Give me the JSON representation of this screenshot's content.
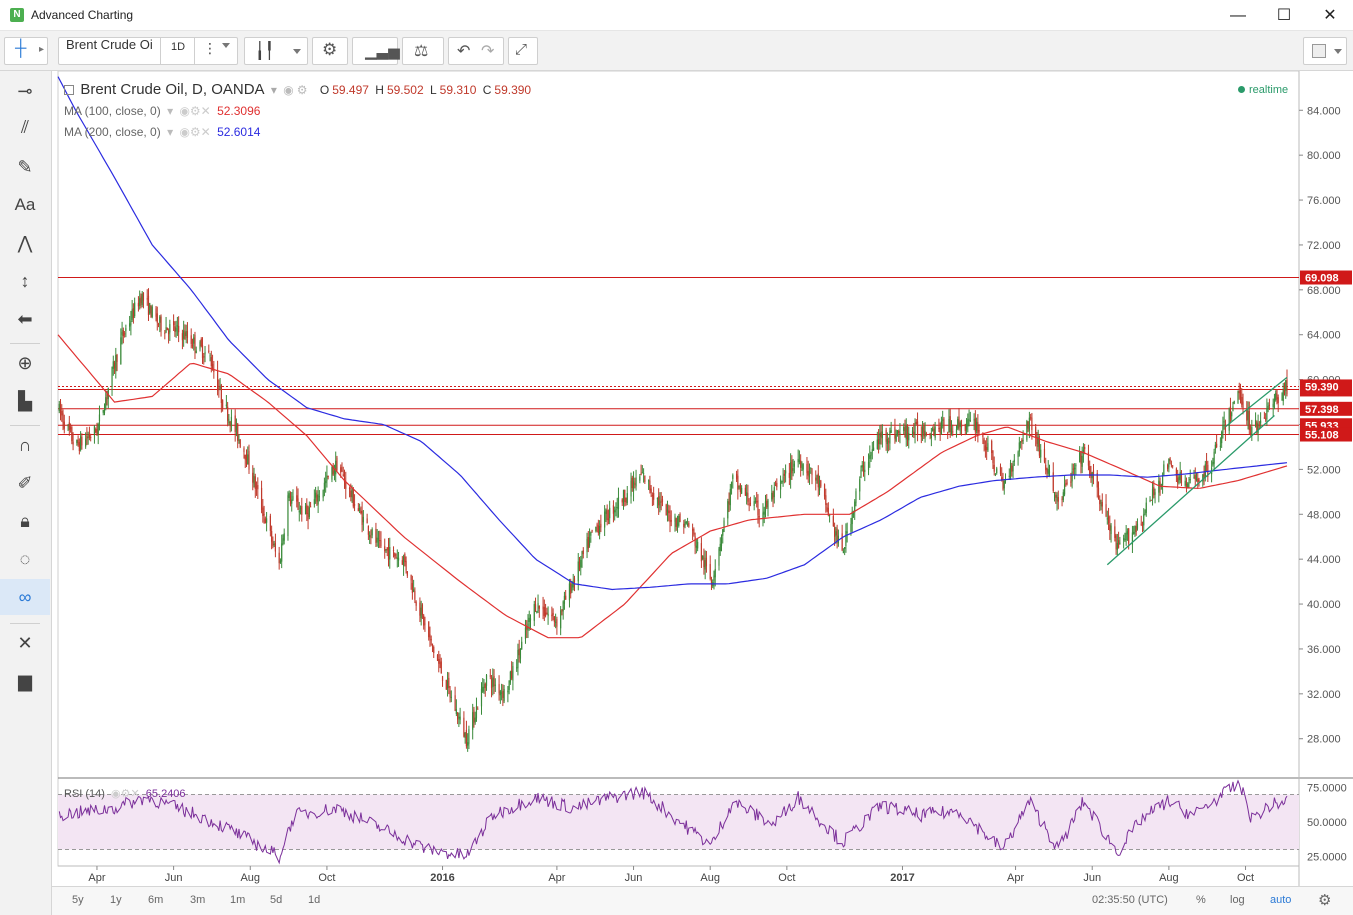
{
  "window": {
    "title": "Advanced Charting",
    "minimize": "—",
    "maximize": "☐",
    "close": "✕"
  },
  "toolbar": {
    "symbol": "Brent Crude Oi",
    "interval": "1D"
  },
  "legend": {
    "title": "Brent Crude Oil, D, OANDA",
    "ohlc": {
      "o_label": "O",
      "o": "59.497",
      "h_label": "H",
      "h": "59.502",
      "l_label": "L",
      "l": "59.310",
      "c_label": "C",
      "c": "59.390"
    },
    "ma100": {
      "label": "MA (100, close, 0)",
      "value": "52.3096"
    },
    "ma200": {
      "label": "MA (200, close, 0)",
      "value": "52.6014"
    },
    "realtime": "realtime",
    "rsi": {
      "label": "RSI (14)",
      "value": "65.2406"
    }
  },
  "bottombar": {
    "ranges": [
      "5y",
      "1y",
      "6m",
      "3m",
      "1m",
      "5d",
      "1d"
    ],
    "time": "02:35:50 (UTC)",
    "percent": "%",
    "log": "log",
    "auto": "auto"
  },
  "colors": {
    "up": "#3a8a3a",
    "down": "#c0392b",
    "ma100": "#e03131",
    "ma200": "#2b2be0",
    "level": "#d01919",
    "trend": "#2a9a6a",
    "rsi": "#7b2f9a",
    "rsi_band": "#f3e5f3"
  },
  "chart_data": {
    "type": "candlestick",
    "symbol": "Brent Crude Oil, D, OANDA",
    "y_ticks": [
      "84.000",
      "80.000",
      "76.000",
      "72.000",
      "68.000",
      "64.000",
      "60.000",
      "56.000",
      "52.000",
      "48.000",
      "44.000",
      "40.000",
      "36.000",
      "32.000",
      "28.000"
    ],
    "ylim": [
      24.5,
      87.5
    ],
    "x_ticks": [
      "Apr",
      "Jun",
      "Aug",
      "Oct",
      "2016",
      "Apr",
      "Jun",
      "Aug",
      "Oct",
      "2017",
      "Apr",
      "Jun",
      "Aug",
      "Oct"
    ],
    "x_tick_bold": [
      false,
      false,
      false,
      false,
      true,
      false,
      false,
      false,
      false,
      true,
      false,
      false,
      false,
      false
    ],
    "x_range": [
      "2015-03-01",
      "2017-11-03"
    ],
    "x_tick_dates": [
      "2015-04-01",
      "2015-06-01",
      "2015-08-01",
      "2015-10-01",
      "2016-01-01",
      "2016-04-01",
      "2016-06-01",
      "2016-08-01",
      "2016-10-01",
      "2017-01-01",
      "2017-04-01",
      "2017-06-01",
      "2017-08-01",
      "2017-10-01"
    ],
    "price_anchors": [
      [
        "2015-03-01",
        57.5
      ],
      [
        "2015-03-15",
        54.0
      ],
      [
        "2015-04-01",
        55.5
      ],
      [
        "2015-04-20",
        63.5
      ],
      [
        "2015-05-06",
        67.5
      ],
      [
        "2015-05-20",
        65.0
      ],
      [
        "2015-06-10",
        64.0
      ],
      [
        "2015-06-30",
        62.0
      ],
      [
        "2015-07-10",
        58.0
      ],
      [
        "2015-07-28",
        53.5
      ],
      [
        "2015-08-24",
        43.5
      ],
      [
        "2015-08-31",
        49.5
      ],
      [
        "2015-09-15",
        48.0
      ],
      [
        "2015-10-09",
        52.5
      ],
      [
        "2015-10-25",
        48.5
      ],
      [
        "2015-11-12",
        45.0
      ],
      [
        "2015-12-01",
        44.0
      ],
      [
        "2015-12-21",
        37.0
      ],
      [
        "2016-01-20",
        28.0
      ],
      [
        "2016-02-05",
        33.5
      ],
      [
        "2016-02-20",
        32.0
      ],
      [
        "2016-03-15",
        40.0
      ],
      [
        "2016-04-01",
        38.5
      ],
      [
        "2016-04-30",
        46.5
      ],
      [
        "2016-06-08",
        51.5
      ],
      [
        "2016-06-27",
        48.0
      ],
      [
        "2016-07-15",
        47.0
      ],
      [
        "2016-08-02",
        42.0
      ],
      [
        "2016-08-19",
        51.0
      ],
      [
        "2016-09-10",
        48.0
      ],
      [
        "2016-10-10",
        53.0
      ],
      [
        "2016-10-25",
        51.0
      ],
      [
        "2016-11-14",
        44.5
      ],
      [
        "2016-11-30",
        52.0
      ],
      [
        "2016-12-15",
        55.0
      ],
      [
        "2017-01-15",
        55.5
      ],
      [
        "2017-02-15",
        56.0
      ],
      [
        "2017-03-01",
        56.0
      ],
      [
        "2017-03-22",
        50.5
      ],
      [
        "2017-04-12",
        56.5
      ],
      [
        "2017-05-05",
        49.0
      ],
      [
        "2017-05-25",
        53.5
      ],
      [
        "2017-06-21",
        44.8
      ],
      [
        "2017-07-10",
        47.5
      ],
      [
        "2017-07-31",
        52.5
      ],
      [
        "2017-08-15",
        50.5
      ],
      [
        "2017-09-01",
        52.0
      ],
      [
        "2017-09-26",
        59.0
      ],
      [
        "2017-10-06",
        55.5
      ],
      [
        "2017-10-20",
        57.5
      ],
      [
        "2017-11-03",
        59.39
      ]
    ],
    "ma100_anchors": [
      [
        "2015-03-01",
        64.0
      ],
      [
        "2015-04-15",
        58.0
      ],
      [
        "2015-05-15",
        58.5
      ],
      [
        "2015-06-15",
        61.5
      ],
      [
        "2015-07-15",
        60.5
      ],
      [
        "2015-08-15",
        58.0
      ],
      [
        "2015-09-15",
        55.0
      ],
      [
        "2015-10-15",
        51.0
      ],
      [
        "2015-12-01",
        46.0
      ],
      [
        "2016-01-15",
        42.0
      ],
      [
        "2016-02-20",
        39.0
      ],
      [
        "2016-03-25",
        37.0
      ],
      [
        "2016-04-20",
        37.0
      ],
      [
        "2016-05-25",
        40.0
      ],
      [
        "2016-07-01",
        44.5
      ],
      [
        "2016-08-01",
        46.5
      ],
      [
        "2016-09-01",
        47.5
      ],
      [
        "2016-10-15",
        48.0
      ],
      [
        "2016-11-20",
        48.0
      ],
      [
        "2016-12-20",
        50.0
      ],
      [
        "2017-02-01",
        53.5
      ],
      [
        "2017-03-01",
        55.0
      ],
      [
        "2017-03-25",
        55.8
      ],
      [
        "2017-04-25",
        54.5
      ],
      [
        "2017-05-25",
        53.5
      ],
      [
        "2017-06-25",
        52.0
      ],
      [
        "2017-07-25",
        50.5
      ],
      [
        "2017-08-25",
        50.3
      ],
      [
        "2017-09-25",
        51.0
      ],
      [
        "2017-11-03",
        52.31
      ]
    ],
    "ma200_anchors": [
      [
        "2015-03-01",
        87.0
      ],
      [
        "2015-03-15",
        84.0
      ],
      [
        "2015-04-15",
        78.0
      ],
      [
        "2015-05-15",
        72.0
      ],
      [
        "2015-06-15",
        68.0
      ],
      [
        "2015-07-15",
        63.5
      ],
      [
        "2015-08-15",
        60.0
      ],
      [
        "2015-09-15",
        57.5
      ],
      [
        "2015-10-15",
        56.5
      ],
      [
        "2015-11-15",
        56.0
      ],
      [
        "2015-12-15",
        54.5
      ],
      [
        "2016-01-15",
        51.5
      ],
      [
        "2016-02-15",
        47.5
      ],
      [
        "2016-03-15",
        44.0
      ],
      [
        "2016-04-15",
        41.8
      ],
      [
        "2016-05-15",
        41.3
      ],
      [
        "2016-06-15",
        41.5
      ],
      [
        "2016-07-15",
        41.8
      ],
      [
        "2016-08-15",
        41.8
      ],
      [
        "2016-09-15",
        42.3
      ],
      [
        "2016-10-15",
        43.5
      ],
      [
        "2016-11-15",
        46.0
      ],
      [
        "2016-12-15",
        47.5
      ],
      [
        "2017-01-15",
        49.5
      ],
      [
        "2017-02-15",
        50.5
      ],
      [
        "2017-03-15",
        51.0
      ],
      [
        "2017-04-15",
        51.3
      ],
      [
        "2017-05-15",
        51.5
      ],
      [
        "2017-06-15",
        51.5
      ],
      [
        "2017-07-15",
        51.3
      ],
      [
        "2017-08-15",
        51.6
      ],
      [
        "2017-09-15",
        52.0
      ],
      [
        "2017-11-03",
        52.6
      ]
    ],
    "rsi_ticks": [
      "75.0000",
      "50.0000",
      "25.0000"
    ],
    "rsi_ylim": [
      18,
      82
    ],
    "rsi_bands": [
      30,
      70
    ],
    "rsi_anchors": [
      [
        "2015-03-01",
        55
      ],
      [
        "2015-04-15",
        60
      ],
      [
        "2015-05-10",
        68
      ],
      [
        "2015-06-20",
        55
      ],
      [
        "2015-07-15",
        45
      ],
      [
        "2015-08-24",
        25
      ],
      [
        "2015-09-05",
        55
      ],
      [
        "2015-10-09",
        60
      ],
      [
        "2015-11-15",
        45
      ],
      [
        "2015-12-20",
        30
      ],
      [
        "2016-01-20",
        25
      ],
      [
        "2016-02-10",
        55
      ],
      [
        "2016-03-15",
        68
      ],
      [
        "2016-04-15",
        60
      ],
      [
        "2016-05-15",
        68
      ],
      [
        "2016-06-08",
        72
      ],
      [
        "2016-07-15",
        45
      ],
      [
        "2016-08-02",
        33
      ],
      [
        "2016-08-19",
        65
      ],
      [
        "2016-09-20",
        48
      ],
      [
        "2016-10-10",
        68
      ],
      [
        "2016-11-14",
        35
      ],
      [
        "2016-12-15",
        62
      ],
      [
        "2017-01-15",
        55
      ],
      [
        "2017-02-15",
        58
      ],
      [
        "2017-03-22",
        30
      ],
      [
        "2017-04-12",
        65
      ],
      [
        "2017-05-05",
        30
      ],
      [
        "2017-05-25",
        65
      ],
      [
        "2017-06-21",
        28
      ],
      [
        "2017-07-10",
        52
      ],
      [
        "2017-07-31",
        65
      ],
      [
        "2017-08-20",
        55
      ],
      [
        "2017-09-26",
        78
      ],
      [
        "2017-10-06",
        52
      ],
      [
        "2017-10-20",
        62
      ],
      [
        "2017-11-03",
        65.24
      ]
    ],
    "horizontal_levels": [
      {
        "value": 69.098,
        "label": "69.098"
      },
      {
        "value": 59.124,
        "label": "59.124"
      },
      {
        "value": 57.398,
        "label": "57.398"
      },
      {
        "value": 55.933,
        "label": "55.933"
      },
      {
        "value": 55.108,
        "label": "55.108"
      }
    ],
    "last_price": {
      "value": 59.39,
      "label": "59.390"
    },
    "trendlines": [
      {
        "from": [
          "2017-06-13",
          43.5
        ],
        "to": [
          "2017-10-24",
          56.8
        ]
      },
      {
        "from": [
          "2017-09-15",
          55.8
        ],
        "to": [
          "2017-11-03",
          60.2
        ]
      }
    ]
  }
}
